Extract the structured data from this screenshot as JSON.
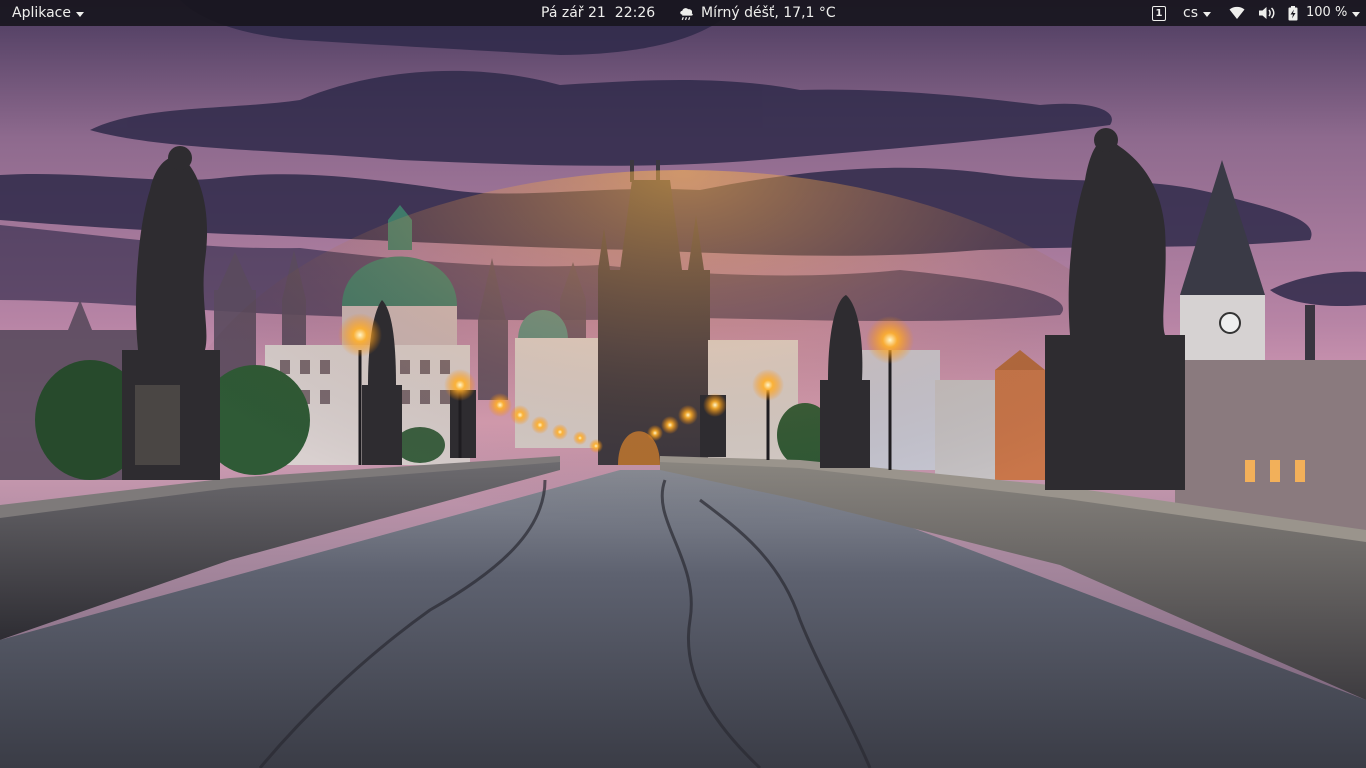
{
  "topbar": {
    "activities_label": "Aplikace",
    "date": "Pá zář 21",
    "time": "22:26",
    "weather": "Mírný déšť, 17,1 °C",
    "weather_icon": "rain-cloud-icon",
    "workspace_number": "1",
    "keyboard_layout": "cs",
    "battery_percent": "100 %",
    "status_icons": [
      "wifi-icon",
      "volume-icon",
      "battery-icon"
    ]
  },
  "wallpaper": {
    "colors": {
      "sky_top": "#4a3a5e",
      "sky_mid": "#b0809e",
      "sky_horizon": "#e3a8bf",
      "cloud": "#2f2a4a",
      "bridge_stone": "#5a5a62",
      "lamp_glow": "#ffb02a",
      "dome_green": "#3f7a6a"
    }
  }
}
